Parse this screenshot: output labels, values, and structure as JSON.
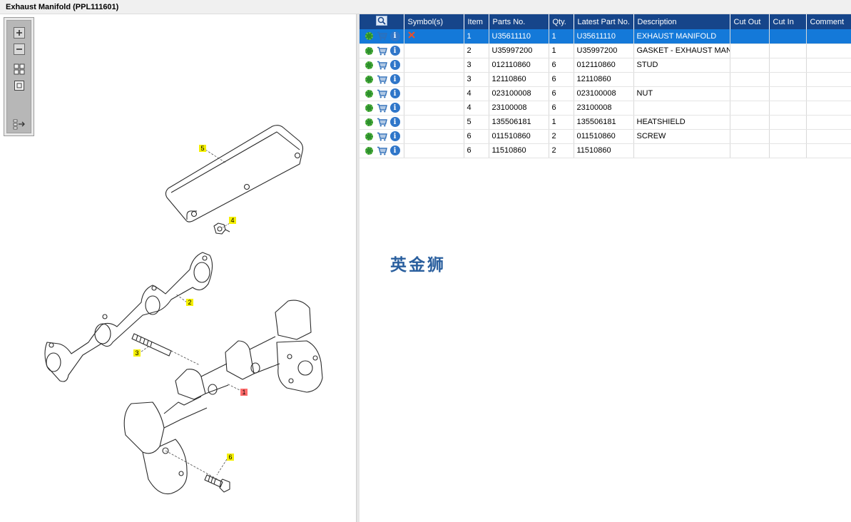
{
  "window": {
    "title": "Exhaust Manifold (PPL111601)"
  },
  "toolbox": {
    "tools": [
      "zoom-in-icon",
      "zoom-out-icon",
      "fit-all-icon",
      "actual-size-icon",
      "toggle-panel-icon"
    ]
  },
  "diagram": {
    "callouts": [
      "1",
      "2",
      "3",
      "4",
      "5",
      "6"
    ],
    "colors": {
      "callout_yellow": "#f5f000",
      "callout_selected": "#ff6b6b",
      "line": "#2a2a2a"
    }
  },
  "table": {
    "columns": [
      "Symbol(s)",
      "Item",
      "Parts No.",
      "Qty.",
      "Latest Part No.",
      "Description",
      "Cut Out",
      "Cut In",
      "Comment"
    ],
    "rows": [
      {
        "symbol": "x",
        "item": "1",
        "part_no": "U35611110",
        "qty": "1",
        "latest": "U35611110",
        "desc": "EXHAUST MANIFOLD",
        "cut_out": "",
        "cut_in": "",
        "comment": ""
      },
      {
        "symbol": "",
        "item": "2",
        "part_no": "U35997200",
        "qty": "1",
        "latest": "U35997200",
        "desc": "GASKET - EXHAUST MANIF",
        "cut_out": "",
        "cut_in": "",
        "comment": ""
      },
      {
        "symbol": "",
        "item": "3",
        "part_no": "012110860",
        "qty": "6",
        "latest": "012110860",
        "desc": "STUD",
        "cut_out": "",
        "cut_in": "",
        "comment": ""
      },
      {
        "symbol": "",
        "item": "3",
        "part_no": "12110860",
        "qty": "6",
        "latest": "12110860",
        "desc": "",
        "cut_out": "",
        "cut_in": "",
        "comment": ""
      },
      {
        "symbol": "",
        "item": "4",
        "part_no": "023100008",
        "qty": "6",
        "latest": "023100008",
        "desc": "NUT",
        "cut_out": "",
        "cut_in": "",
        "comment": ""
      },
      {
        "symbol": "",
        "item": "4",
        "part_no": "23100008",
        "qty": "6",
        "latest": "23100008",
        "desc": "",
        "cut_out": "",
        "cut_in": "",
        "comment": ""
      },
      {
        "symbol": "",
        "item": "5",
        "part_no": "135506181",
        "qty": "1",
        "latest": "135506181",
        "desc": "HEATSHIELD",
        "cut_out": "",
        "cut_in": "",
        "comment": ""
      },
      {
        "symbol": "",
        "item": "6",
        "part_no": "011510860",
        "qty": "2",
        "latest": "011510860",
        "desc": "SCREW",
        "cut_out": "",
        "cut_in": "",
        "comment": ""
      },
      {
        "symbol": "",
        "item": "6",
        "part_no": "11510860",
        "qty": "2",
        "latest": "11510860",
        "desc": "",
        "cut_out": "",
        "cut_in": "",
        "comment": ""
      }
    ],
    "row_icons": [
      "gear-icon",
      "cart-icon",
      "info-icon"
    ],
    "colors": {
      "header": "#16458a",
      "selected": "#1479d9",
      "symbol_x": "#e8502a"
    }
  },
  "watermark": {
    "text": "英金狮"
  }
}
